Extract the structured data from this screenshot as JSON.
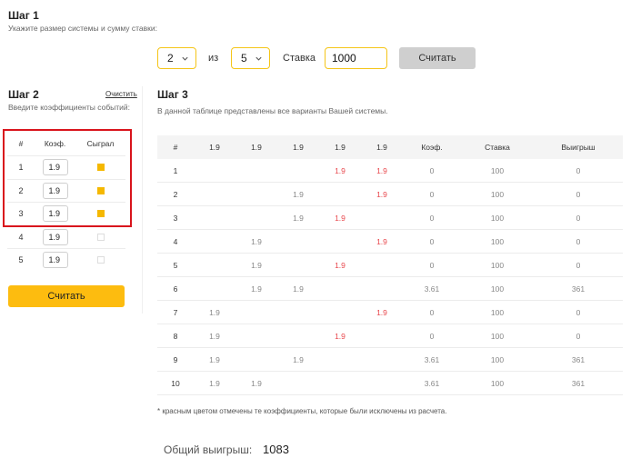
{
  "step1": {
    "title": "Шаг 1",
    "subtitle": "Укажите размер системы и сумму ставки:",
    "system_k": "2",
    "of_label": "из",
    "system_n": "5",
    "stake_label": "Ставка",
    "stake_value": "1000",
    "calc_button": "Считать"
  },
  "step2": {
    "title": "Шаг 2",
    "subtitle": "Введите коэффициенты событий:",
    "clear_link": "Очистить",
    "headers": {
      "num": "#",
      "koef": "Коэф.",
      "won": "Сыграл"
    },
    "rows": [
      {
        "num": "1",
        "koef": "1.9",
        "won": true
      },
      {
        "num": "2",
        "koef": "1.9",
        "won": true
      },
      {
        "num": "3",
        "koef": "1.9",
        "won": true
      },
      {
        "num": "4",
        "koef": "1.9",
        "won": false
      },
      {
        "num": "5",
        "koef": "1.9",
        "won": false
      }
    ],
    "calc_button": "Считать"
  },
  "step3": {
    "title": "Шаг 3",
    "subtitle": "В данной таблице представлены все варианты Вашей системы.",
    "headers": [
      "#",
      "1.9",
      "1.9",
      "1.9",
      "1.9",
      "1.9",
      "Коэф.",
      "Ставка",
      "Выигрыш"
    ],
    "header_red": [
      false,
      false,
      false,
      false,
      true,
      true,
      false,
      false,
      false
    ],
    "rows": [
      {
        "n": "1",
        "c": [
          "",
          "",
          "",
          "1.9",
          "1.9"
        ],
        "red": [
          false,
          false,
          false,
          true,
          true
        ],
        "koef": "0",
        "stake": "100",
        "win": "0"
      },
      {
        "n": "2",
        "c": [
          "",
          "",
          "1.9",
          "",
          "1.9"
        ],
        "red": [
          false,
          false,
          false,
          false,
          true
        ],
        "koef": "0",
        "stake": "100",
        "win": "0"
      },
      {
        "n": "3",
        "c": [
          "",
          "",
          "1.9",
          "1.9",
          ""
        ],
        "red": [
          false,
          false,
          false,
          true,
          false
        ],
        "koef": "0",
        "stake": "100",
        "win": "0"
      },
      {
        "n": "4",
        "c": [
          "",
          "1.9",
          "",
          "",
          "1.9"
        ],
        "red": [
          false,
          false,
          false,
          false,
          true
        ],
        "koef": "0",
        "stake": "100",
        "win": "0"
      },
      {
        "n": "5",
        "c": [
          "",
          "1.9",
          "",
          "1.9",
          ""
        ],
        "red": [
          false,
          false,
          false,
          true,
          false
        ],
        "koef": "0",
        "stake": "100",
        "win": "0"
      },
      {
        "n": "6",
        "c": [
          "",
          "1.9",
          "1.9",
          "",
          ""
        ],
        "red": [
          false,
          false,
          false,
          false,
          false
        ],
        "koef": "3.61",
        "stake": "100",
        "win": "361"
      },
      {
        "n": "7",
        "c": [
          "1.9",
          "",
          "",
          "",
          "1.9"
        ],
        "red": [
          false,
          false,
          false,
          false,
          true
        ],
        "koef": "0",
        "stake": "100",
        "win": "0"
      },
      {
        "n": "8",
        "c": [
          "1.9",
          "",
          "",
          "1.9",
          ""
        ],
        "red": [
          false,
          false,
          false,
          true,
          false
        ],
        "koef": "0",
        "stake": "100",
        "win": "0"
      },
      {
        "n": "9",
        "c": [
          "1.9",
          "",
          "1.9",
          "",
          ""
        ],
        "red": [
          false,
          false,
          false,
          false,
          false
        ],
        "koef": "3.61",
        "stake": "100",
        "win": "361"
      },
      {
        "n": "10",
        "c": [
          "1.9",
          "1.9",
          "",
          "",
          ""
        ],
        "red": [
          false,
          false,
          false,
          false,
          false
        ],
        "koef": "3.61",
        "stake": "100",
        "win": "361"
      }
    ],
    "footnote": "* красным цветом отмечены те коэффициенты, которые были исключены из расчета.",
    "total_label": "Общий выигрыш:",
    "total_value": "1083"
  },
  "colors": {
    "accent": "#fdbc0f",
    "excluded": "#e8474c",
    "highlight_box": "#d9141c"
  }
}
